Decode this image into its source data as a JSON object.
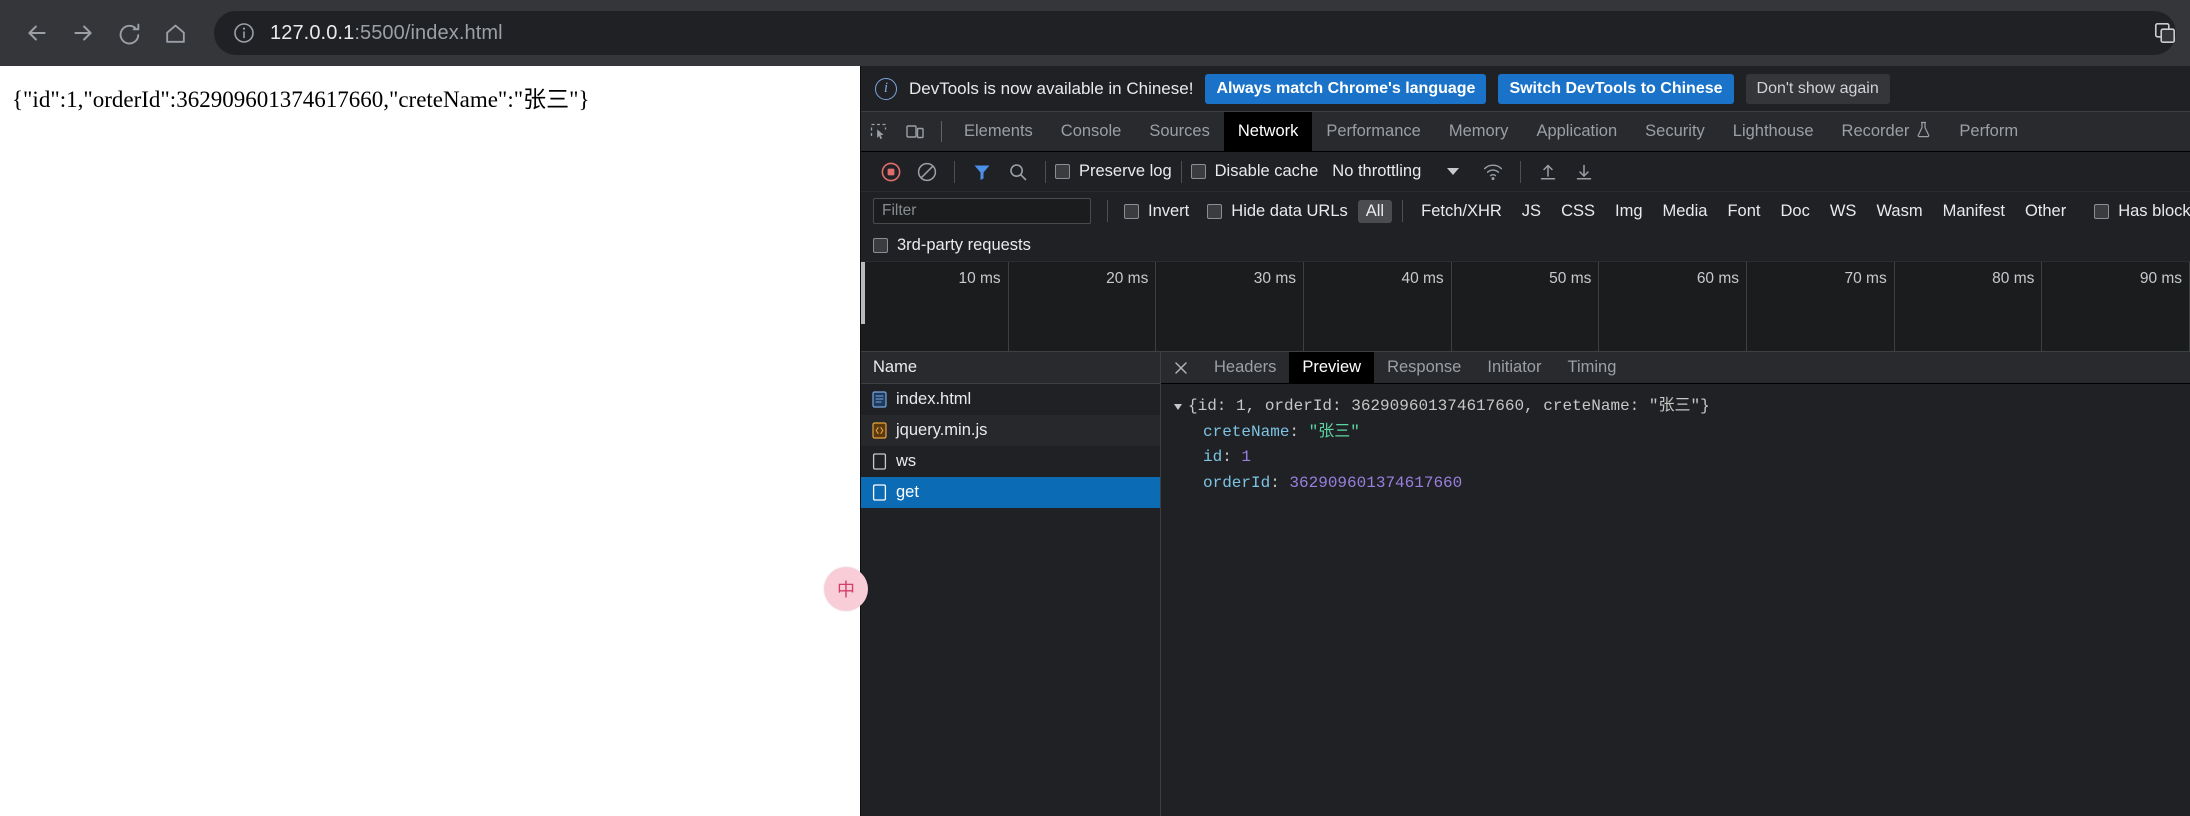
{
  "browser": {
    "nav": {
      "back_icon": "arrow-left-icon",
      "forward_icon": "arrow-right-icon",
      "reload_icon": "reload-icon",
      "home_icon": "home-icon"
    },
    "omnibox": {
      "info_icon": "info-circle-icon",
      "host": "127.0.0.1",
      "path": ":5500/index.html",
      "full_url": "127.0.0.1:5500/index.html"
    },
    "extensions_icon": "extensions-icon"
  },
  "page": {
    "body_text": "{\"id\":1,\"orderId\":362909601374617660,\"creteName\":\"张三\"}",
    "floating_badge": "中"
  },
  "devtools": {
    "infobar": {
      "icon": "info-circle-icon",
      "message": "DevTools is now available in Chinese!",
      "primary_button": "Always match Chrome's language",
      "secondary_button": "Switch DevTools to Chinese",
      "dismiss_button": "Don't show again"
    },
    "toolbar_icons": {
      "inspect": "inspect-element-icon",
      "device": "device-toolbar-icon"
    },
    "panel_tabs": [
      {
        "label": "Elements",
        "active": false
      },
      {
        "label": "Console",
        "active": false
      },
      {
        "label": "Sources",
        "active": false
      },
      {
        "label": "Network",
        "active": true
      },
      {
        "label": "Performance",
        "active": false
      },
      {
        "label": "Memory",
        "active": false
      },
      {
        "label": "Application",
        "active": false
      },
      {
        "label": "Security",
        "active": false
      },
      {
        "label": "Lighthouse",
        "active": false
      },
      {
        "label": "Recorder",
        "active": false,
        "badge": "flask-icon"
      },
      {
        "label": "Perform",
        "active": false
      }
    ],
    "network_toolbar": {
      "record_icon": "record-stop-icon",
      "clear_icon": "clear-network-icon",
      "filter_icon": "filter-funnel-icon",
      "search_icon": "search-icon",
      "preserve_log_label": "Preserve log",
      "preserve_log_checked": false,
      "disable_cache_label": "Disable cache",
      "disable_cache_checked": false,
      "throttling_value": "No throttling",
      "throttling_caret": "chevron-down-icon",
      "wifi_icon": "network-conditions-icon",
      "import_icon": "import-har-icon",
      "export_icon": "export-har-icon"
    },
    "filter_row": {
      "filter_placeholder": "Filter",
      "filter_value": "",
      "invert_label": "Invert",
      "invert_checked": false,
      "hide_data_urls_label": "Hide data URLs",
      "hide_data_urls_checked": false,
      "types": [
        {
          "label": "All",
          "active": true
        },
        {
          "label": "Fetch/XHR",
          "active": false
        },
        {
          "label": "JS",
          "active": false
        },
        {
          "label": "CSS",
          "active": false
        },
        {
          "label": "Img",
          "active": false
        },
        {
          "label": "Media",
          "active": false
        },
        {
          "label": "Font",
          "active": false
        },
        {
          "label": "Doc",
          "active": false
        },
        {
          "label": "WS",
          "active": false
        },
        {
          "label": "Wasm",
          "active": false
        },
        {
          "label": "Manifest",
          "active": false
        },
        {
          "label": "Other",
          "active": false
        }
      ],
      "has_blocked_label": "Has blocked",
      "has_blocked_checked": false,
      "third_party_label": "3rd-party requests",
      "third_party_checked": false
    },
    "overview": {
      "ticks": [
        "10 ms",
        "20 ms",
        "30 ms",
        "40 ms",
        "50 ms",
        "60 ms",
        "70 ms",
        "80 ms",
        "90 ms"
      ]
    },
    "request_list": {
      "column_header": "Name",
      "rows": [
        {
          "name": "index.html",
          "icon": "document-icon",
          "selected": false
        },
        {
          "name": "jquery.min.js",
          "icon": "script-icon",
          "selected": false
        },
        {
          "name": "ws",
          "icon": "generic-file-icon",
          "selected": false
        },
        {
          "name": "get",
          "icon": "generic-file-icon",
          "selected": true
        }
      ]
    },
    "detail": {
      "close_icon": "close-icon",
      "tabs": [
        {
          "label": "Headers",
          "active": false
        },
        {
          "label": "Preview",
          "active": true
        },
        {
          "label": "Response",
          "active": false
        },
        {
          "label": "Initiator",
          "active": false
        },
        {
          "label": "Timing",
          "active": false
        }
      ],
      "preview": {
        "root_summary": "{id: 1, orderId: 362909601374617660, creteName: \"张三\"}",
        "root_parts": {
          "open": "{",
          "k1": "id",
          "v1": "1",
          "k2": "orderId",
          "v2": "362909601374617660",
          "k3": "creteName",
          "v3": "\"张三\"",
          "close": "}"
        },
        "entries": [
          {
            "key": "creteName",
            "value": "\"张三\"",
            "type": "string"
          },
          {
            "key": "id",
            "value": "1",
            "type": "number"
          },
          {
            "key": "orderId",
            "value": "362909601374617660",
            "type": "number"
          }
        ]
      }
    }
  },
  "colors": {
    "accent_blue": "#1a73c8",
    "selection_blue": "#0b6bb5",
    "devtools_bg": "#202124",
    "string_green": "#5bd6a2",
    "number_purple": "#9a7fe0",
    "key_blue": "#7dc4e4"
  }
}
